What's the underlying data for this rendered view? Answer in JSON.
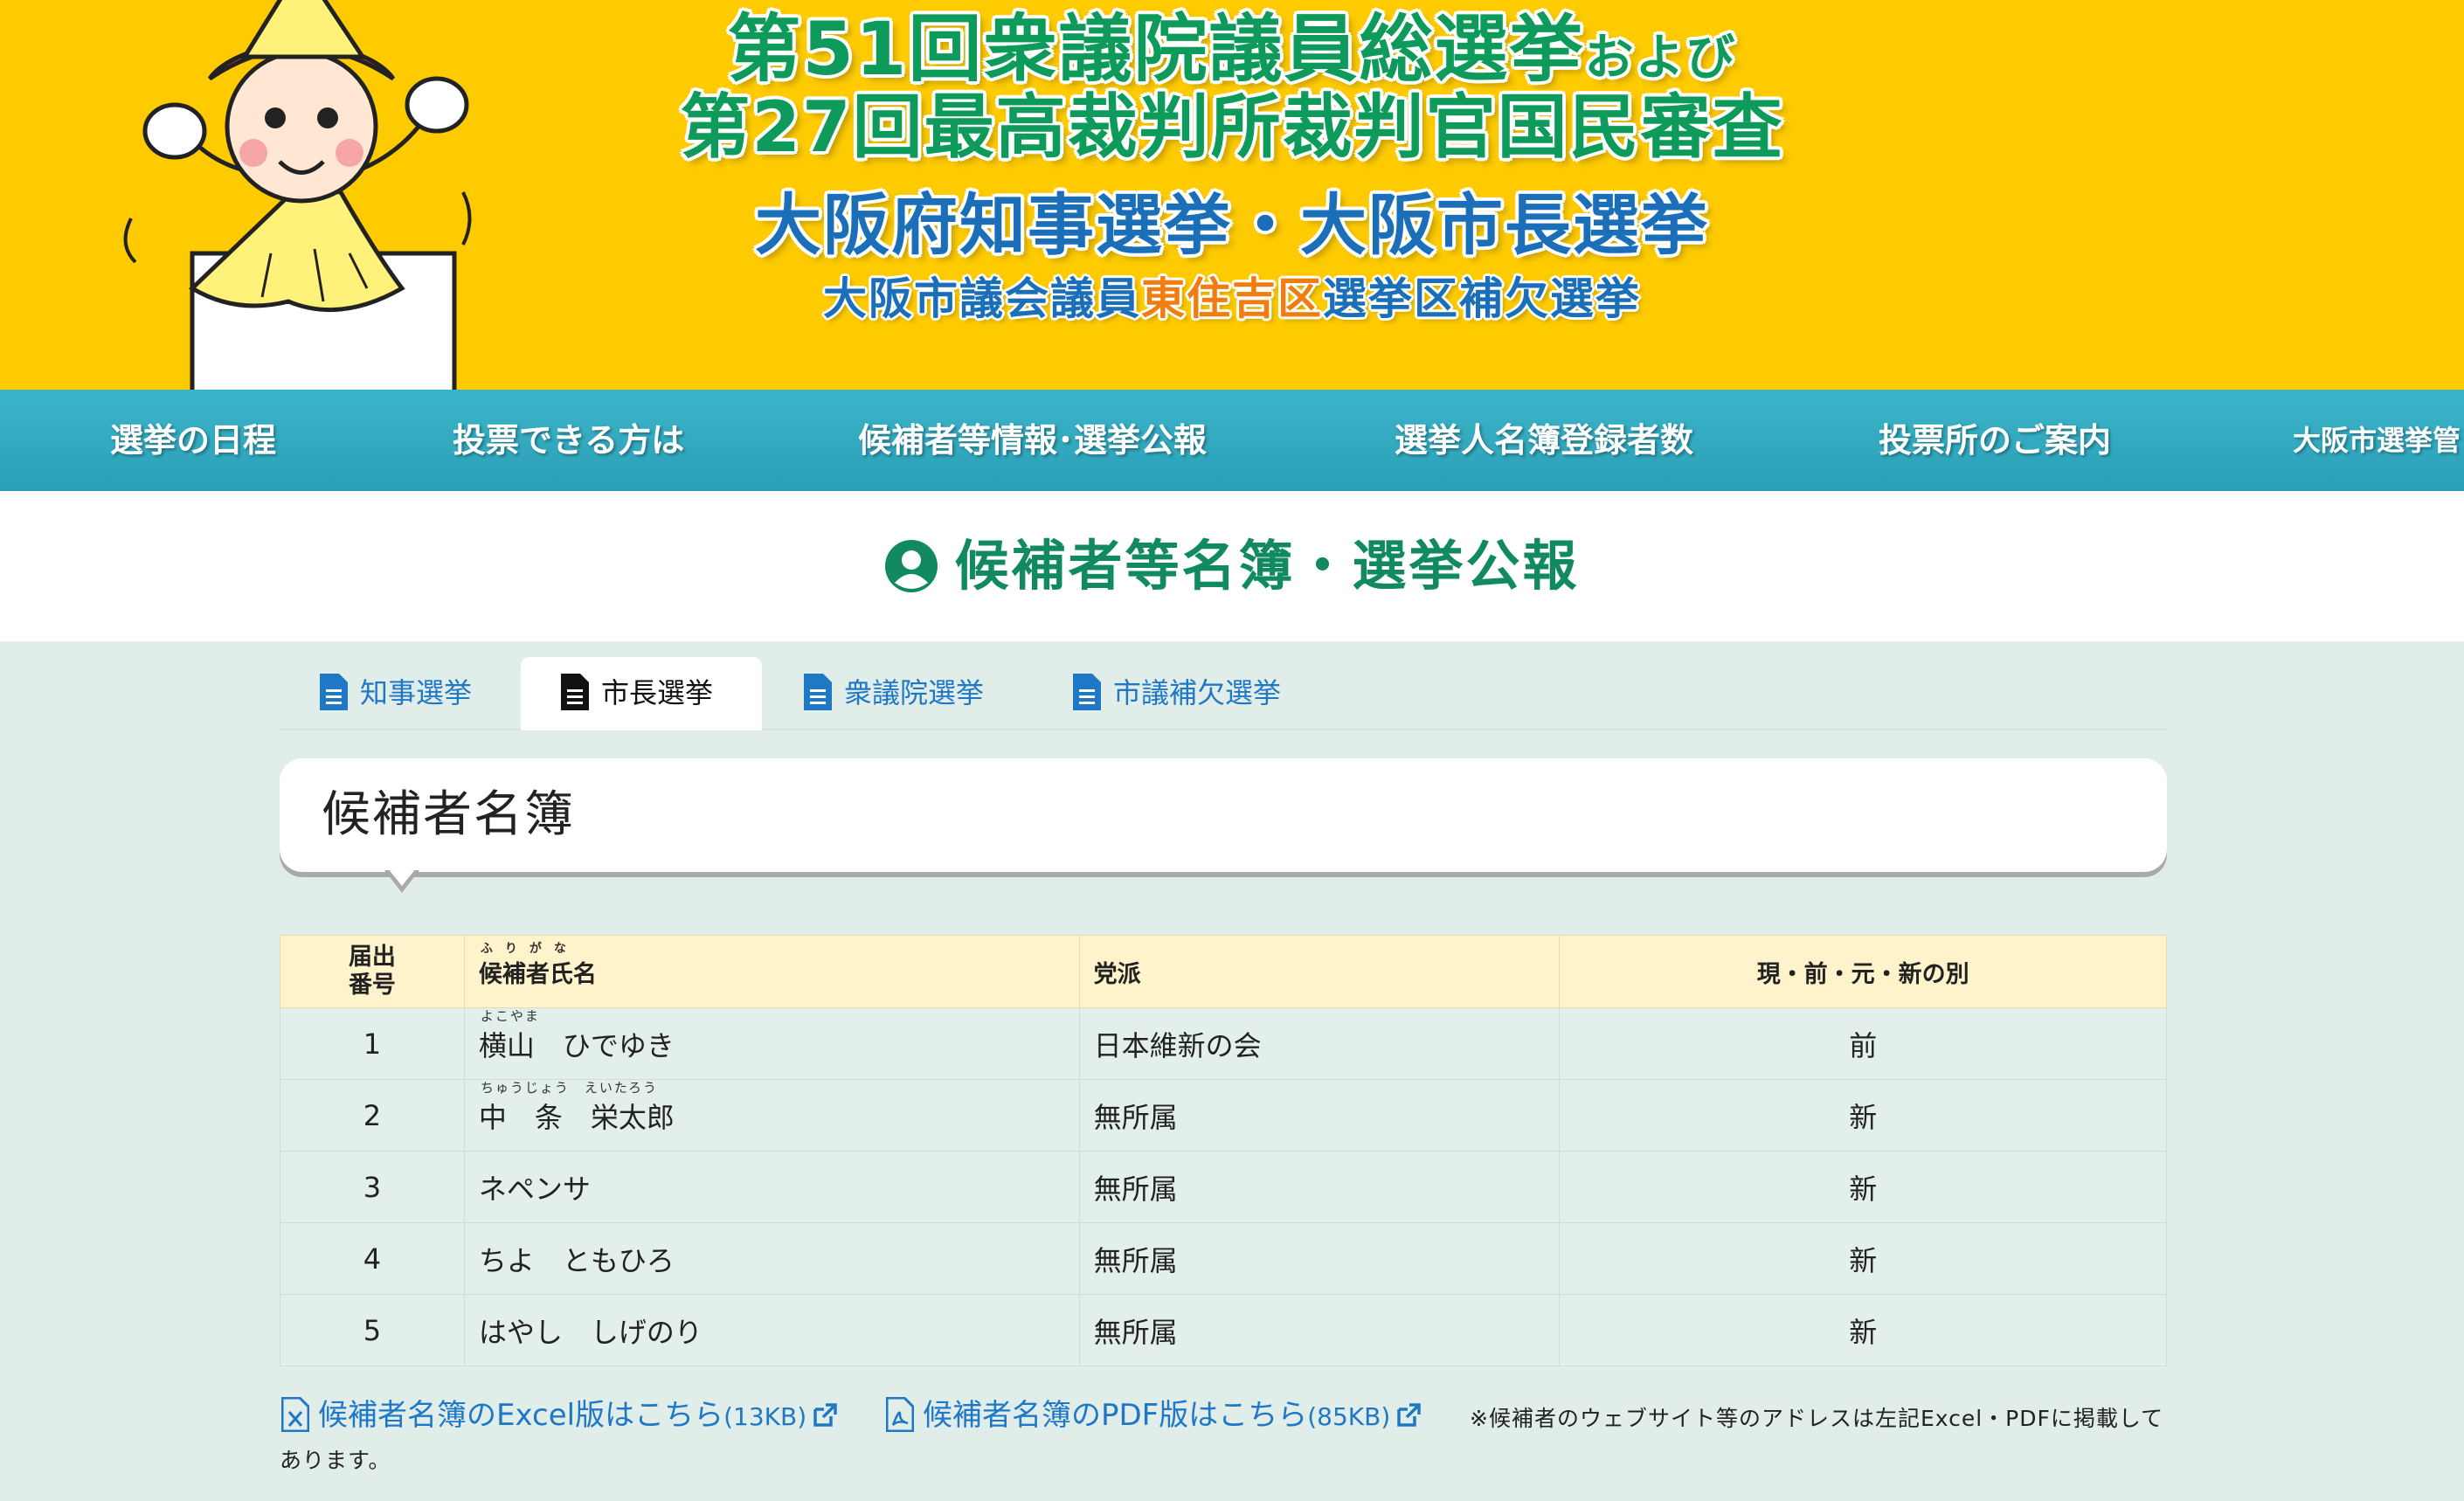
{
  "header": {
    "line1_main": "第51回衆議院議員総選挙",
    "line1_suffix": "および",
    "line2": "第27回最高裁判所裁判官国民審査",
    "line3": "大阪府知事選挙・大阪市長選挙",
    "line4_a": "大阪市議会議員",
    "line4_b": "東住吉区",
    "line4_c": "選挙区補欠選挙",
    "colors": {
      "banner": "#fecb00",
      "green": "#0e9a5a",
      "blue": "#1a6fb8",
      "orange": "#ef7d12"
    }
  },
  "nav": {
    "items": [
      "選挙の日程",
      "投票できる方は",
      "候補者等情報･選挙公報",
      "選挙人名簿登録者数",
      "投票所のご案内",
      "大阪市選挙管"
    ],
    "color": "#2aa0b8"
  },
  "page": {
    "title": "候補者等名簿・選挙公報",
    "icon": "user-circle-icon"
  },
  "tabs": [
    {
      "label": "知事選挙",
      "active": false
    },
    {
      "label": "市長選挙",
      "active": true
    },
    {
      "label": "衆議院選挙",
      "active": false
    },
    {
      "label": "市議補欠選挙",
      "active": false
    }
  ],
  "section": {
    "title": "候補者名簿"
  },
  "table": {
    "headers": {
      "number_line1": "届出",
      "number_line2": "番号",
      "name": "候補者氏名",
      "name_furigana": "ふりがな",
      "party": "党派",
      "status": "現・前・元・新の別"
    },
    "rows": [
      {
        "no": "1",
        "name": "横山　ひでゆき",
        "furigana": "よこやま",
        "party": "日本維新の会",
        "status": "前"
      },
      {
        "no": "2",
        "name": "中　条　栄太郎",
        "furigana": "ちゅうじょう　えいたろう",
        "party": "無所属",
        "status": "新"
      },
      {
        "no": "3",
        "name": "ネペンサ",
        "furigana": "",
        "party": "無所属",
        "status": "新"
      },
      {
        "no": "4",
        "name": "ちよ　ともひろ",
        "furigana": "",
        "party": "無所属",
        "status": "新"
      },
      {
        "no": "5",
        "name": "はやし　しげのり",
        "furigana": "",
        "party": "無所属",
        "status": "新"
      }
    ]
  },
  "downloads": {
    "excel_label": "候補者名簿のExcel版はこちら",
    "excel_size": "(13KB)",
    "pdf_label": "候補者名簿のPDF版はこちら",
    "pdf_size": "(85KB)",
    "note": "※候補者のウェブサイト等のアドレスは左記Excel・PDFに掲載してあります。"
  }
}
